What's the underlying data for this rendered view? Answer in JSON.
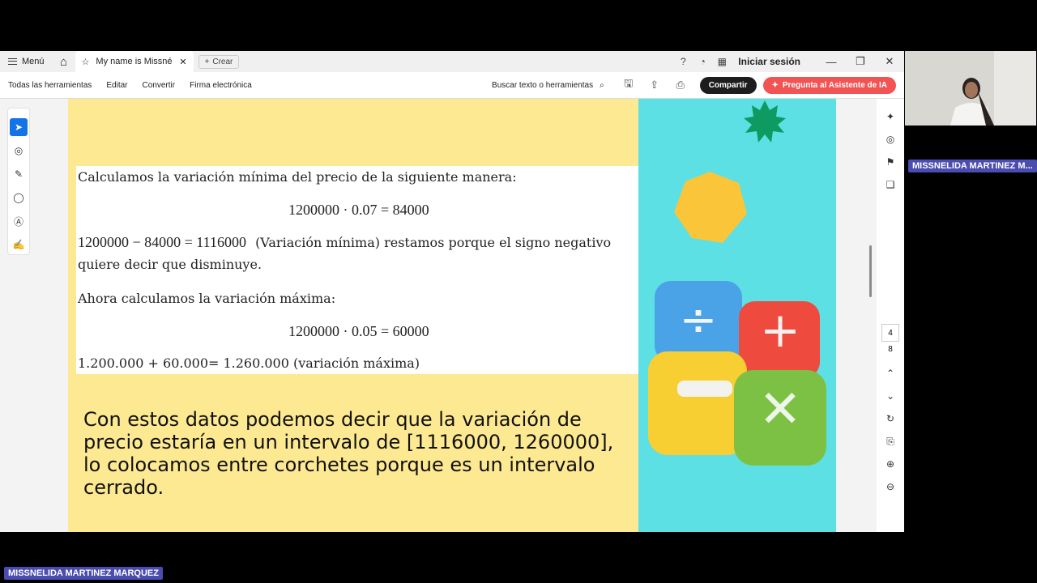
{
  "titlebar": {
    "menu_label": "Menú",
    "tab_title": "My name is Missnélid...",
    "new_tab_label": "Crear",
    "signin_label": "Iniciar sesión"
  },
  "toolbar": {
    "items": [
      "Todas las herramientas",
      "Editar",
      "Convertir",
      "Firma electrónica"
    ],
    "search_label": "Buscar texto o herramientas",
    "share_label": "Compartir",
    "ai_label": "Pregunta al Asistente de IA"
  },
  "document": {
    "line1": "Calculamos la variación mínima del precio de la siguiente manera:",
    "eq1": "1200000 · 0.07 = 84000",
    "line2a": "1200000 − 84000 = 1116000",
    "line2b": "(Variación mínima) restamos porque el signo negativo",
    "line3": "quiere decir que disminuye.",
    "line4": "Ahora calculamos la variación máxima:",
    "eq2": "1200000 · 0.05 = 60000",
    "line5": "1.200.000 + 60.000= 1.260.000 (variación máxima)",
    "conclusion": "Con estos datos podemos decir que la variación de precio estaría en un intervalo de [1116000, 1260000], lo colocamos entre corchetes porque es un intervalo cerrado."
  },
  "pager": {
    "current": "4",
    "total": "8"
  },
  "participants": {
    "camera_name": "MISSNELIDA MARTINEZ M...",
    "presenter_name": "MISSNELIDA MARTINEZ MARQUEZ"
  },
  "colors": {
    "page_bg": "#fde992",
    "side_panel": "#5ce0e3",
    "ai_button": "#f25353",
    "name_badge": "#4a4cb0"
  }
}
